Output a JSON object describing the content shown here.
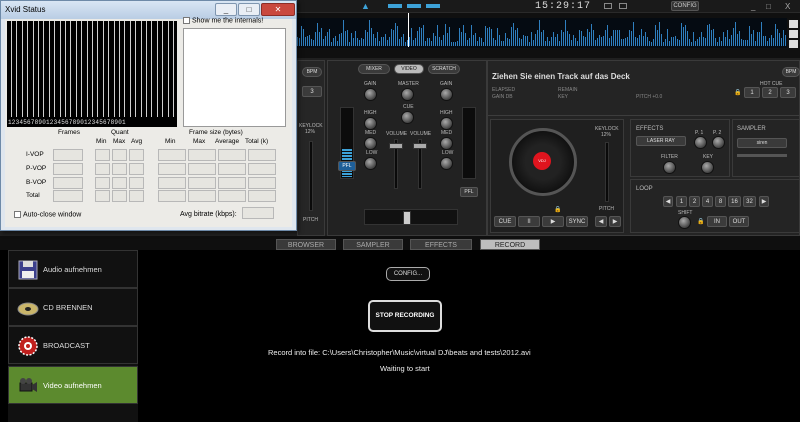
{
  "window_title": "Xvid Status",
  "xvid": {
    "graph_numbers": "1234567890123456789012345678901",
    "show_internals": "Show me the internals!",
    "col_frames": "Frames",
    "col_quant": "Quant",
    "quant_min": "Min",
    "quant_max": "Max",
    "quant_avg": "Avg",
    "col_framesize": "Frame size (bytes)",
    "fs_min": "Min",
    "fs_max": "Max",
    "fs_avg": "Average",
    "fs_total": "Total (k)",
    "rows": [
      "I-VOP",
      "P-VOP",
      "B-VOP",
      "Total"
    ],
    "auto_close": "Auto-close window",
    "avg_bitrate": "Avg bitrate (kbps):"
  },
  "top": {
    "clock": "15:29:17",
    "config_button": "CONFIG",
    "window_min": "_",
    "window_max": "□",
    "window_close": "X"
  },
  "mixer": {
    "tabs": [
      "MIXER",
      "VIDEO",
      "SCRATCH"
    ],
    "gain": "GAIN",
    "master": "MASTER",
    "cue": "CUE",
    "high": "HIGH",
    "med": "MED",
    "low": "LOW",
    "volume": "VOLUME",
    "pfl": "PFL"
  },
  "deck_left": {
    "bpm": "BPM",
    "btn3": "3",
    "keylock": "KEYLOCK",
    "keylock_pct": "12%",
    "pitch": "PITCH"
  },
  "deck_right": {
    "title": "Ziehen Sie einen Track auf das Deck",
    "elapsed": "ELAPSED",
    "gain_db": "GAIN dB",
    "remain": "REMAIN",
    "key": "KEY",
    "pitch": "PITCH +0.0",
    "bpm": "BPM",
    "hot_cue": "HOT CUE",
    "hot_cue_buttons": [
      "1",
      "2",
      "3"
    ],
    "keylock": "KEYLOCK",
    "keylock_pct": "12%",
    "pitch_label": "PITCH",
    "transport": [
      "CUE",
      "II",
      "▶",
      "SYNC"
    ],
    "effects": "EFFECTS",
    "effect_name": "LASER RAY",
    "p1": "P. 1",
    "p2": "P. 2",
    "filter": "FILTER",
    "key_knob": "KEY",
    "sampler": "SAMPLER",
    "sampler_name": "siren",
    "loop": "LOOP",
    "loop_values": [
      "1",
      "2",
      "4",
      "8",
      "16",
      "32"
    ],
    "shift": "SHIFT",
    "in": "IN",
    "out": "OUT",
    "platter_label": "VDJ"
  },
  "tabs": [
    "BROWSER",
    "SAMPLER",
    "EFFECTS",
    "RECORD"
  ],
  "active_tab": "RECORD",
  "sidebar": [
    {
      "label": "Audio aufnehmen",
      "icon": "floppy-disk-icon"
    },
    {
      "label": "CD BRENNEN",
      "icon": "cd-icon"
    },
    {
      "label": "BROADCAST",
      "icon": "broadcast-icon"
    },
    {
      "label": "Video aufnehmen",
      "icon": "video-camera-icon"
    }
  ],
  "record": {
    "config": "CONFIG...",
    "stop": "STOP RECORDING",
    "file": "Record into file: C:\\Users\\Christopher\\Music\\virtual DJ\\beats and tests\\2012.avi",
    "status": "Waiting to start"
  },
  "colors": {
    "accent_blue": "#3da2d8",
    "active_green": "#5c8a2e",
    "platter_red": "#e0141e"
  }
}
